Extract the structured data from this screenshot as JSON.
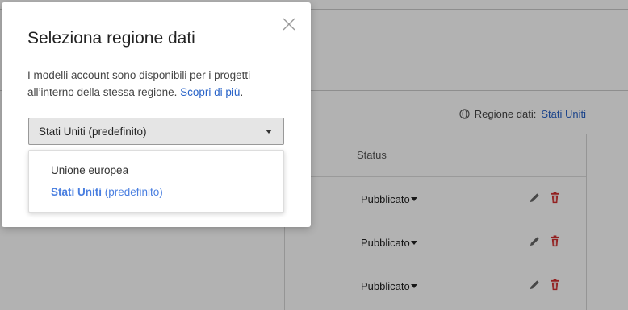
{
  "background": {
    "region_label": "Regione dati:",
    "region_value": "Stati Uniti",
    "table": {
      "status_header": "Status",
      "rows": [
        {
          "status": "Pubblicato"
        },
        {
          "status": "Pubblicato"
        },
        {
          "status": "Pubblicato"
        }
      ]
    }
  },
  "modal": {
    "title": "Seleziona regione dati",
    "description": "I modelli account sono disponibili per i progetti all’interno della stessa regione.",
    "learn_more": "Scopri di più",
    "description_end": ".",
    "select_value": "Stati Uniti (predefinito)",
    "options": [
      {
        "label": "Unione europea"
      },
      {
        "label_strong": "Stati Uniti",
        "label_suffix": "(predefinito)"
      }
    ]
  },
  "colors": {
    "link": "#2a64c8",
    "selected_option": "#4a7fe0",
    "delete": "#d32f2f"
  }
}
